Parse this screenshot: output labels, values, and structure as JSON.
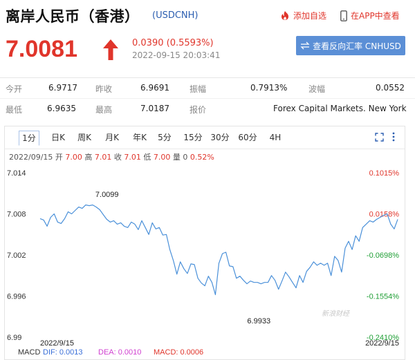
{
  "header": {
    "title": "离岸人民币（香港）",
    "code": "(USDCNH)",
    "add_fav": "添加自选",
    "view_app": "在APP中查看"
  },
  "quote": {
    "price": "7.0081",
    "change": "0.0390 (0.5593%)",
    "time": "2022-09-15 20:03:41",
    "reverse_button": "查看反向汇率 CNHUSD",
    "up_color": "#e0352b",
    "down_color": "#1e9e34"
  },
  "stats": {
    "open_label": "今开",
    "open": "6.9717",
    "prev_close_label": "昨收",
    "prev_close": "6.9691",
    "amplitude_label": "振幅",
    "amplitude": "0.7913%",
    "wave_label": "波幅",
    "wave": "0.0552",
    "low_label": "最低",
    "low": "6.9635",
    "high_label": "最高",
    "high": "7.0187",
    "quote_label": "报价",
    "quote_source": "Forex Capital Markets. New York"
  },
  "tabs": [
    "1分",
    "日K",
    "周K",
    "月K",
    "年K",
    "5分",
    "15分",
    "30分",
    "60分",
    "4H"
  ],
  "active_tab": "1分",
  "icons": {
    "fullscreen": "fullscreen-icon",
    "more": "more-vertical-icon"
  },
  "infoline": {
    "date": "2022/09/15",
    "open_label": "开",
    "open": "7.00",
    "high_label": "高",
    "high": "7.01",
    "close_label": "收",
    "close": "7.01",
    "low_label": "低",
    "low": "7.00",
    "vol_label": "量",
    "vol": "0",
    "pct": "0.52%"
  },
  "watermark": "新浪财经",
  "macd": {
    "label": "MACD",
    "dif": "DIF: 0.0013",
    "dea": "DEA: 0.0010",
    "macd": "MACD: 0.0006",
    "dif_color": "#3a6fd8",
    "dea_color": "#d040d0",
    "macd_color": "#e0352b"
  },
  "chart_data": {
    "type": "line",
    "y_ticks": [
      "7.014",
      "7.008",
      "7.002",
      "6.996",
      "6.99"
    ],
    "pct_ticks": [
      "0.1015%",
      "0.0158%",
      "-0.0698%",
      "-0.1554%",
      "-0.2410%"
    ],
    "ylim": [
      6.99,
      7.014
    ],
    "x_start_label": "2022/9/15",
    "x_end_label": "2022/9/15",
    "high_annotation": "7.0099",
    "low_annotation": "6.9933",
    "line_color": "#4a90d9",
    "series": [
      {
        "values": [
          7.0073,
          7.0071,
          7.0062,
          7.0075,
          7.008,
          7.0068,
          7.0066,
          7.0073,
          7.0083,
          7.008,
          7.0085,
          7.009,
          7.0088,
          7.0093,
          7.0092,
          7.0093,
          7.009,
          7.0086,
          7.0079,
          7.0072,
          7.0068,
          7.007,
          7.0065,
          7.0067,
          7.0062,
          7.006,
          7.0068,
          7.0065,
          7.0057,
          7.007,
          7.006,
          7.005,
          7.0067,
          7.0058,
          7.006,
          7.0049,
          7.005,
          7.0028,
          7.0012,
          6.9992,
          7.001,
          7.0,
          6.9993,
          7.0007,
          7.0006,
          6.9986,
          6.9979,
          6.9975,
          6.9989,
          6.998,
          6.9962,
          7.0008,
          7.0022,
          7.0024,
          7.0004,
          7.0003,
          6.9986,
          6.9989,
          6.9983,
          6.9978,
          6.9982,
          6.998,
          6.998,
          6.9978,
          6.998,
          6.998,
          6.999,
          6.9983,
          6.997,
          6.9982,
          6.9995,
          6.9988,
          6.998,
          6.9972,
          6.999,
          6.998,
          6.9996,
          7.0002,
          7.001,
          7.0005,
          7.0008,
          7.0005,
          7.0008,
          6.999,
          7.0018,
          7.0012,
          6.9995,
          7.003,
          7.004,
          7.0028,
          7.0048,
          7.004,
          7.006,
          7.0065,
          7.007,
          7.0068,
          7.0072,
          7.0075,
          7.0078,
          7.008,
          7.0065,
          7.0058,
          7.0072
        ]
      }
    ]
  }
}
